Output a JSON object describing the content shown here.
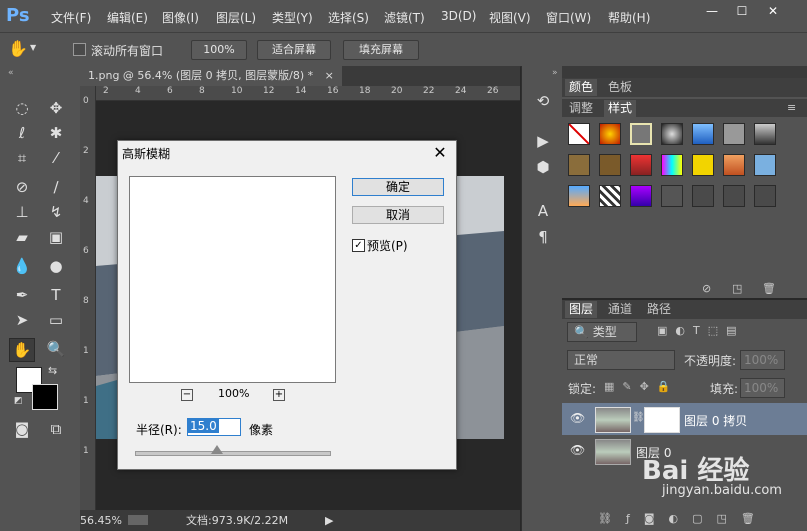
{
  "app": {
    "logo": "Ps"
  },
  "menubar": {
    "items": [
      "文件(F)",
      "编辑(E)",
      "图像(I)",
      "图层(L)",
      "类型(Y)",
      "选择(S)",
      "滤镜(T)",
      "3D(D)",
      "视图(V)",
      "窗口(W)",
      "帮助(H)"
    ],
    "minimize": "—",
    "maximize": "☐",
    "close": "✕"
  },
  "options": {
    "scroll_all_label": "滚动所有窗口",
    "zoom_100": "100%",
    "fit_screen": "适合屏幕",
    "fill_screen": "填充屏幕"
  },
  "document": {
    "tab_title": "1.png @ 56.4% (图层 0 拷贝, 图层蒙版/8) *",
    "tab_close": "×",
    "ruler_top": [
      "2",
      "4",
      "6",
      "8",
      "10",
      "12",
      "14",
      "16",
      "18",
      "20",
      "22",
      "24",
      "26"
    ],
    "ruler_left": [
      "0",
      "2",
      "4",
      "6",
      "8",
      "1",
      "1",
      "1"
    ],
    "zoom": "56.45%",
    "doc_size": "文档:973.9K/2.22M"
  },
  "right_panel": {
    "tabs_top": [
      "颜色",
      "色板"
    ],
    "tabs_second": [
      "调整",
      "样式"
    ],
    "layers_tabs": [
      "图层",
      "通道",
      "路径"
    ],
    "kind_filter": "类型",
    "blend_mode": "正常",
    "opacity_label": "不透明度:",
    "opacity_value": "100%",
    "lock_label": "锁定:",
    "fill_label": "填充:",
    "fill_value": "100%",
    "layers": [
      {
        "name": "图层 0 拷贝",
        "selected": true
      },
      {
        "name": "图层 0",
        "selected": false
      }
    ],
    "watermark": "Bai 经验",
    "watermark_url": "jingyan.baidu.com"
  },
  "dialog": {
    "title": "高斯模糊",
    "close": "✕",
    "ok": "确定",
    "cancel": "取消",
    "preview_label": "预览(P)",
    "preview_checked": true,
    "zoom_value": "100%",
    "zoom_minus": "−",
    "zoom_plus": "+",
    "radius_label": "半径(R):",
    "radius_value": "15.0",
    "radius_unit": "像素"
  },
  "colors": {
    "accent": "#2f7fce",
    "selected_layer": "#6c7d95"
  }
}
